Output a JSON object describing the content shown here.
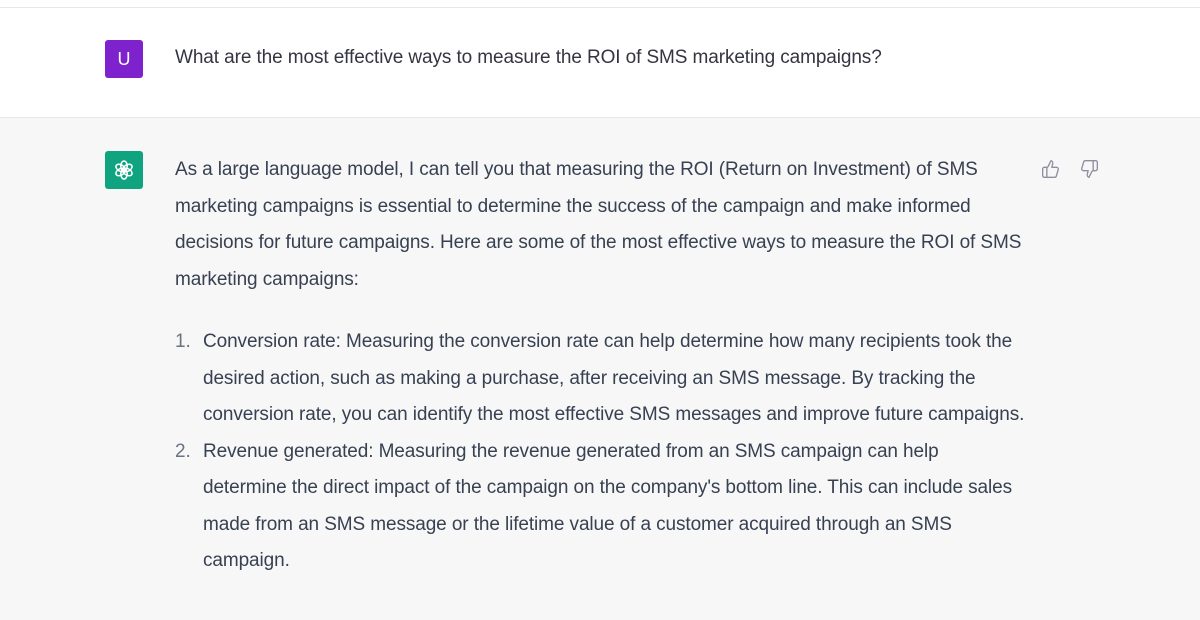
{
  "user_message": {
    "avatar_initial": "U",
    "text": "What are the most effective ways to measure the ROI of SMS marketing campaigns?"
  },
  "assistant_message": {
    "intro": "As a large language model, I can tell you that measuring the ROI (Return on Investment) of SMS marketing campaigns is essential to determine the success of the campaign and make informed decisions for future campaigns. Here are some of the most effective ways to measure the ROI of SMS marketing campaigns:",
    "items": [
      {
        "number": "1.",
        "text": "Conversion rate: Measuring the conversion rate can help determine how many recipients took the desired action, such as making a purchase, after receiving an SMS message. By tracking the conversion rate, you can identify the most effective SMS messages and improve future campaigns."
      },
      {
        "number": "2.",
        "text": "Revenue generated: Measuring the revenue generated from an SMS campaign can help determine the direct impact of the campaign on the company's bottom line. This can include sales made from an SMS message or the lifetime value of a customer acquired through an SMS campaign."
      }
    ]
  },
  "icons": {
    "user_avatar_color": "#7e22ce",
    "bot_avatar_color": "#10a37f",
    "bot_logo": "openai-logo-icon",
    "thumbs_up": "thumbs-up-icon",
    "thumbs_down": "thumbs-down-icon"
  }
}
